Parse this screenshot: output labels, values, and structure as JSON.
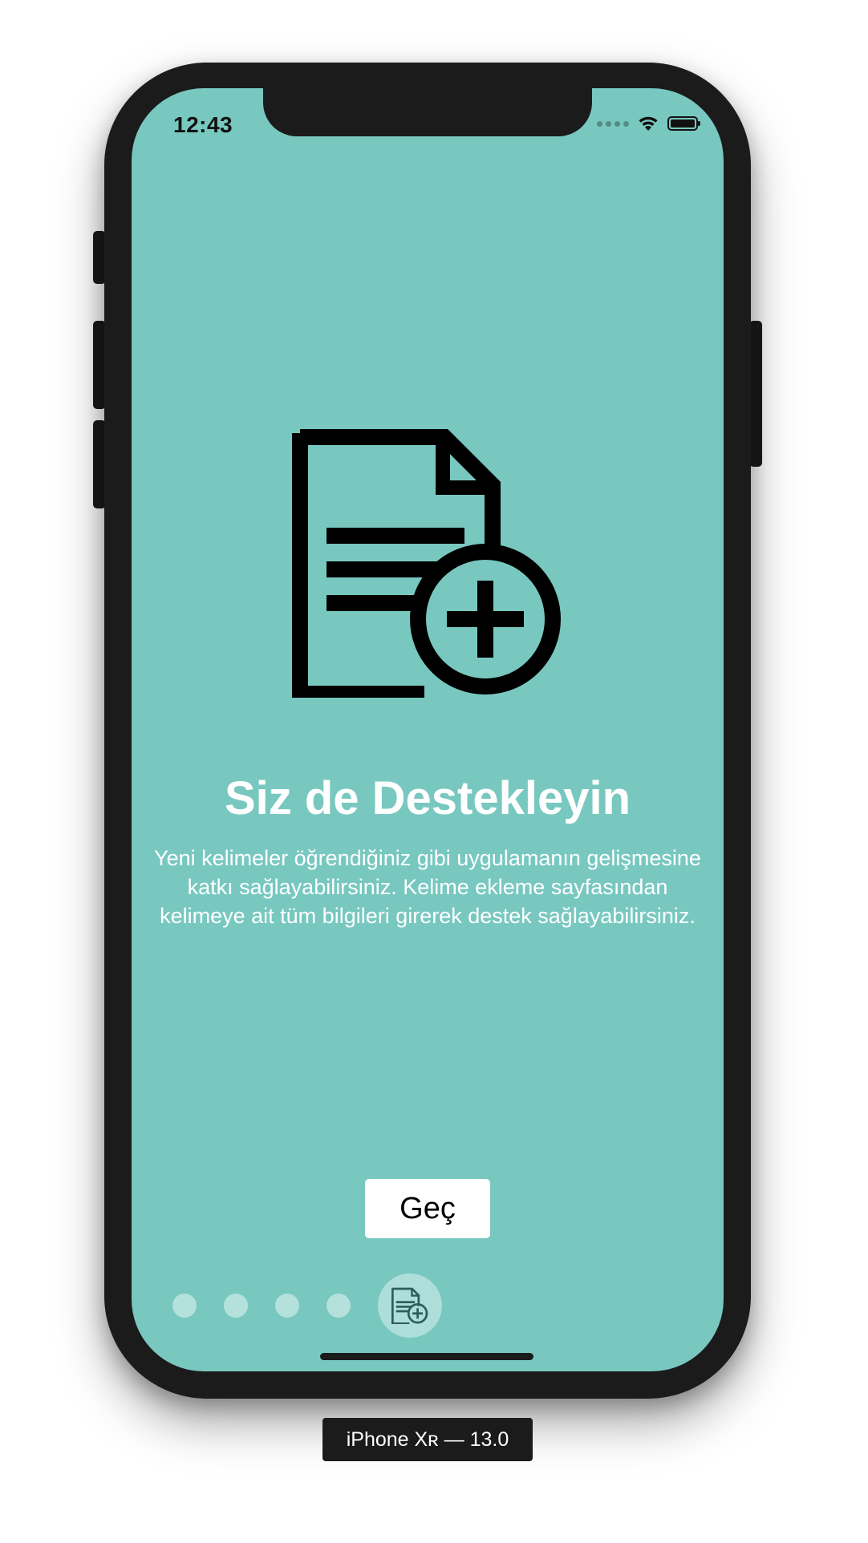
{
  "status_bar": {
    "time": "12:43",
    "icons": [
      "signal-dots-icon",
      "wifi-icon",
      "battery-icon"
    ]
  },
  "onboarding": {
    "icon": "document-add-icon",
    "title": "Siz de Destekleyin",
    "description": "Yeni kelimeler öğrendiğiniz gibi uygulamanın gelişmesine katkı sağlayabilirsiniz. Kelime ekleme sayfasından kelimeye ait tüm bilgileri girerek destek sağlayabilirsiniz.",
    "skip_label": "Geç"
  },
  "pager": {
    "total_pages": 5,
    "current_page": 5,
    "active_icon": "document-add-icon"
  },
  "simulator": {
    "device_label": "iPhone Xʀ — 13.0"
  },
  "colors": {
    "background": "#78c8c0",
    "text": "#ffffff",
    "button_bg": "#ffffff",
    "frame": "#1b1b1b"
  }
}
